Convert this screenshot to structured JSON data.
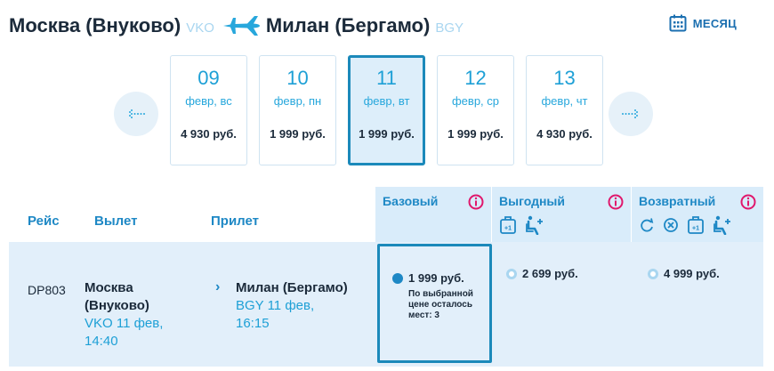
{
  "route": {
    "from_city": "Москва (Внуково)",
    "from_code": "VKO",
    "to_city": "Милан (Бергамо)",
    "to_code": "BGY",
    "plane_icon": "airplane-icon"
  },
  "month_button": {
    "label": "МЕСЯЦ",
    "icon": "calendar-icon"
  },
  "dates": [
    {
      "day": "09",
      "weekday": "февр, вс",
      "price": "4 930 руб.",
      "selected": false
    },
    {
      "day": "10",
      "weekday": "февр, пн",
      "price": "1 999 руб.",
      "selected": false
    },
    {
      "day": "11",
      "weekday": "февр, вт",
      "price": "1 999 руб.",
      "selected": true
    },
    {
      "day": "12",
      "weekday": "февр, ср",
      "price": "1 999 руб.",
      "selected": false
    },
    {
      "day": "13",
      "weekday": "февр, чт",
      "price": "4 930 руб.",
      "selected": false
    }
  ],
  "table": {
    "headers": {
      "flight": "Рейс",
      "departure": "Вылет",
      "arrival": "Прилет"
    },
    "fares": [
      {
        "name": "Базовый",
        "icons": []
      },
      {
        "name": "Выгодный",
        "icons": [
          "luggage-plus-icon",
          "seat-plus-icon"
        ]
      },
      {
        "name": "Возвратный",
        "icons": [
          "refresh-icon",
          "cancel-icon",
          "luggage-plus-icon",
          "seat-plus-icon"
        ]
      }
    ]
  },
  "flight": {
    "number": "DP803",
    "dep_city_line1": "Москва",
    "dep_city_line2": "(Внуково)",
    "dep_time_line1": "VKO 11 фев,",
    "dep_time_line2": "14:40",
    "arr_city": "Милан (Бергамо)",
    "arr_time_line1": "BGY 11 фев,",
    "arr_time_line2": "16:15",
    "fares": [
      {
        "price": "1 999 руб.",
        "note": "По выбранной цене осталось мест: 3",
        "selected": true
      },
      {
        "price": "2 699 руб.",
        "selected": false
      },
      {
        "price": "4 999 руб.",
        "selected": false
      }
    ]
  },
  "colors": {
    "accent": "#1e88c5",
    "light_blue": "#d9ecfa",
    "row_bg": "#e2effa",
    "info": "#e0186c"
  }
}
